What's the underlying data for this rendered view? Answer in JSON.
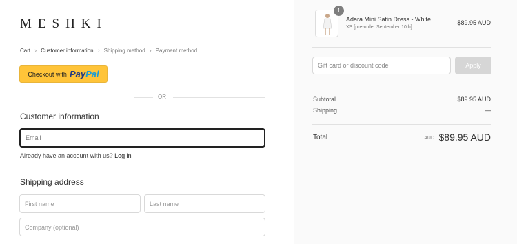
{
  "brand": {
    "logo": "MESHKI"
  },
  "breadcrumb": [
    {
      "label": "Cart"
    },
    {
      "label": "Customer information"
    },
    {
      "label": "Shipping method"
    },
    {
      "label": "Payment method"
    }
  ],
  "paypal": {
    "prefix": "Checkout with",
    "logo_part1": "Pay",
    "logo_part2": "Pal"
  },
  "divider_text": "OR",
  "customer_info": {
    "title": "Customer information",
    "email_placeholder": "Email",
    "account_prompt": "Already have an account with us?",
    "login_label": "Log in"
  },
  "shipping": {
    "title": "Shipping address",
    "first_name_placeholder": "First name",
    "last_name_placeholder": "Last name",
    "company_placeholder": "Company (optional)"
  },
  "order": {
    "item": {
      "quantity": "1",
      "name": "Adara Mini Satin Dress - White",
      "variant": "XS [pre-order September 10th]",
      "price": "$89.95 AUD"
    },
    "discount_placeholder": "Gift card or discount code",
    "apply_label": "Apply",
    "subtotal_label": "Subtotal",
    "subtotal_value": "$89.95 AUD",
    "shipping_label": "Shipping",
    "shipping_value": "—",
    "total_label": "Total",
    "total_currency": "AUD",
    "total_value": "$89.95 AUD"
  },
  "colors": {
    "paypal_yellow": "#ffc439",
    "paypal_dark_blue": "#253b80",
    "paypal_light_blue": "#179bd7"
  }
}
